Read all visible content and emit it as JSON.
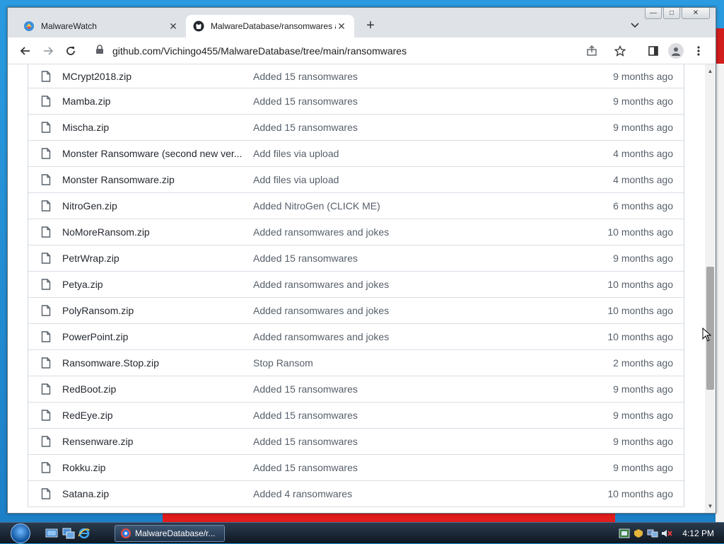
{
  "browser": {
    "tabs": [
      {
        "title": "MalwareWatch",
        "active": false
      },
      {
        "title": "MalwareDatabase/ransomwares a",
        "active": true
      }
    ],
    "address": "github.com/Vichingo455/MalwareDatabase/tree/main/ransomwares"
  },
  "files": [
    {
      "name": "MCrypt2018.zip",
      "commit": "Added 15 ransomwares",
      "age": "9 months ago"
    },
    {
      "name": "Mamba.zip",
      "commit": "Added 15 ransomwares",
      "age": "9 months ago"
    },
    {
      "name": "Mischa.zip",
      "commit": "Added 15 ransomwares",
      "age": "9 months ago"
    },
    {
      "name": "Monster Ransomware (second new ver...",
      "commit": "Add files via upload",
      "age": "4 months ago"
    },
    {
      "name": "Monster Ransomware.zip",
      "commit": "Add files via upload",
      "age": "4 months ago"
    },
    {
      "name": "NitroGen.zip",
      "commit": "Added NitroGen (CLICK ME)",
      "age": "6 months ago"
    },
    {
      "name": "NoMoreRansom.zip",
      "commit": "Added ransomwares and jokes",
      "age": "10 months ago"
    },
    {
      "name": "PetrWrap.zip",
      "commit": "Added 15 ransomwares",
      "age": "9 months ago"
    },
    {
      "name": "Petya.zip",
      "commit": "Added ransomwares and jokes",
      "age": "10 months ago"
    },
    {
      "name": "PolyRansom.zip",
      "commit": "Added ransomwares and jokes",
      "age": "10 months ago"
    },
    {
      "name": "PowerPoint.zip",
      "commit": "Added ransomwares and jokes",
      "age": "10 months ago"
    },
    {
      "name": "Ransomware.Stop.zip",
      "commit": "Stop Ransom",
      "age": "2 months ago"
    },
    {
      "name": "RedBoot.zip",
      "commit": "Added 15 ransomwares",
      "age": "9 months ago"
    },
    {
      "name": "RedEye.zip",
      "commit": "Added 15 ransomwares",
      "age": "9 months ago"
    },
    {
      "name": "Rensenware.zip",
      "commit": "Added 15 ransomwares",
      "age": "9 months ago"
    },
    {
      "name": "Rokku.zip",
      "commit": "Added 15 ransomwares",
      "age": "9 months ago"
    },
    {
      "name": "Satana.zip",
      "commit": "Added 4 ransomwares",
      "age": "10 months ago"
    }
  ],
  "taskbar": {
    "active_window": "MalwareDatabase/r...",
    "clock": "4:12 PM"
  }
}
